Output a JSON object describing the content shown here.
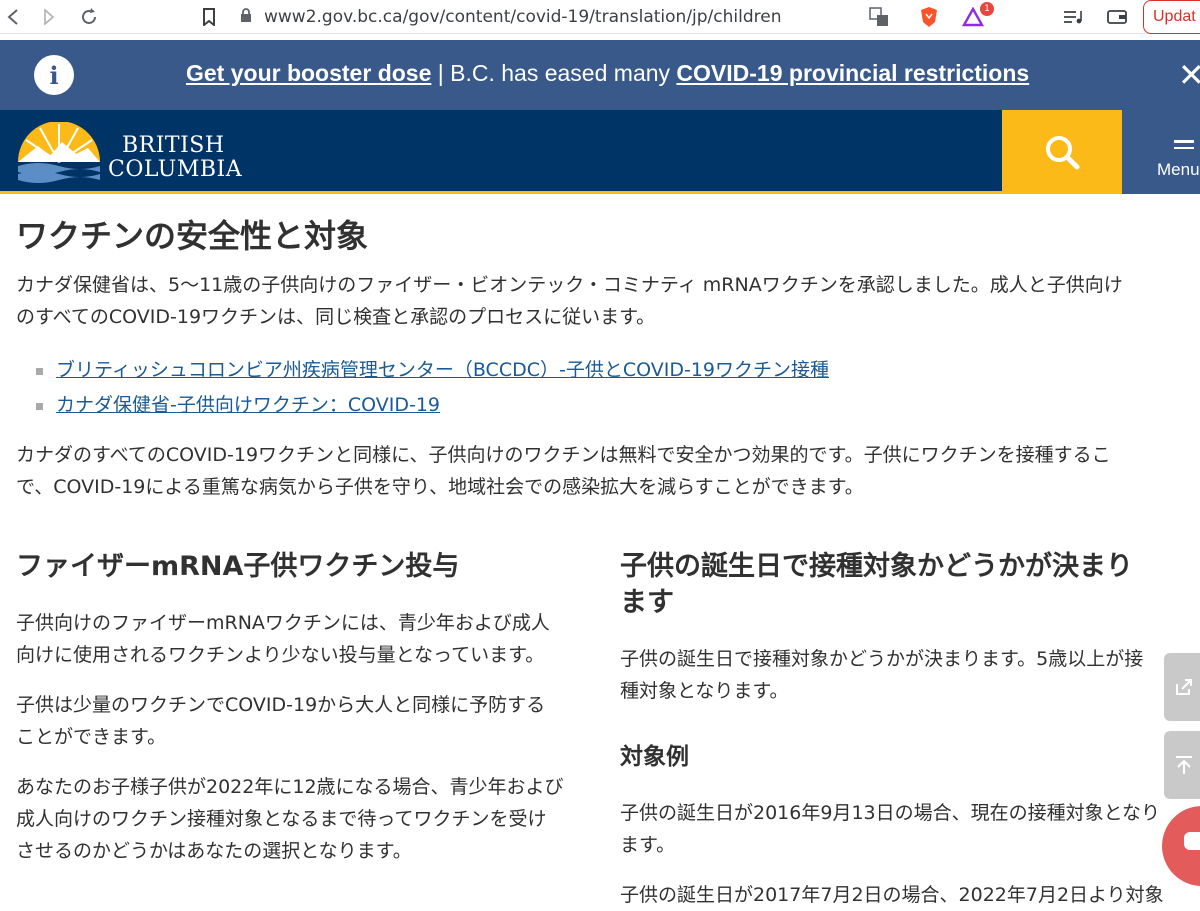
{
  "browser": {
    "url": "www2.gov.bc.ca/gov/content/covid-19/translation/jp/children",
    "notification_count": "1",
    "update_label": "Updat"
  },
  "alert": {
    "link1": "Get your booster dose",
    "separator": " | B.C. has eased many ",
    "link2": "COVID-19 provincial restrictions",
    "close_symbol": "✕"
  },
  "header": {
    "logo_line1": "BRITISH",
    "logo_line2": "COLUMBIA",
    "menu_label": "Menu"
  },
  "main": {
    "title": "ワクチンの安全性と対象",
    "intro_line1": "カナダ保健省は、5〜11歳の子供向けのファイザー・ビオンテック・コミナティ mRNAワクチンを承認しました。成人と子供向け",
    "intro_line2": "のすべてのCOVID-19ワクチンは、同じ検査と承認のプロセスに従います。",
    "links": [
      "ブリティッシュコロンビア州疾病管理センター（BCCDC）-子供とCOVID-19ワクチン接種",
      "カナダ保健省-子供向けワクチン：COVID-19"
    ],
    "para2_line1": "カナダのすべてのCOVID-19ワクチンと同様に、子供向けのワクチンは無料で安全かつ効果的です。子供にワクチンを接種するこ",
    "para2_line2": "で、COVID-19による重篤な病気から子供を守り、地域社会での感染拡大を減らすことができます。"
  },
  "left_col": {
    "heading": "ファイザーmRNA子供ワクチン投与",
    "p1_line1": "子供向けのファイザーmRNAワクチンには、青少年および成人",
    "p1_line2": "向けに使用されるワクチンより少ない投与量となっています。",
    "p2_line1": "子供は少量のワクチンでCOVID-19から大人と同様に予防する",
    "p2_line2": "ことができます。",
    "p3_line1": "あなたのお子様子供が2022年に12歳になる場合、青少年および",
    "p3_line2": "成人向けのワクチン接種対象となるまで待ってワクチンを受け",
    "p3_line3": "させるのかどうかはあなたの選択となります。"
  },
  "right_col": {
    "heading_line1": "子供の誕生日で接種対象かどうかが決まり",
    "heading_line2": "ます",
    "p1_line1": "子供の誕生日で接種対象かどうかが決まります。5歳以上が接",
    "p1_line2": "種対象となります。",
    "subheading": "対象例",
    "ex1_line1": "子供の誕生日が2016年9月13日の場合、現在の接種対象となり",
    "ex1_line2": "ます。",
    "ex2_line1": "子供の誕生日が2017年7月2日の場合、2022年7月2日より対象"
  }
}
